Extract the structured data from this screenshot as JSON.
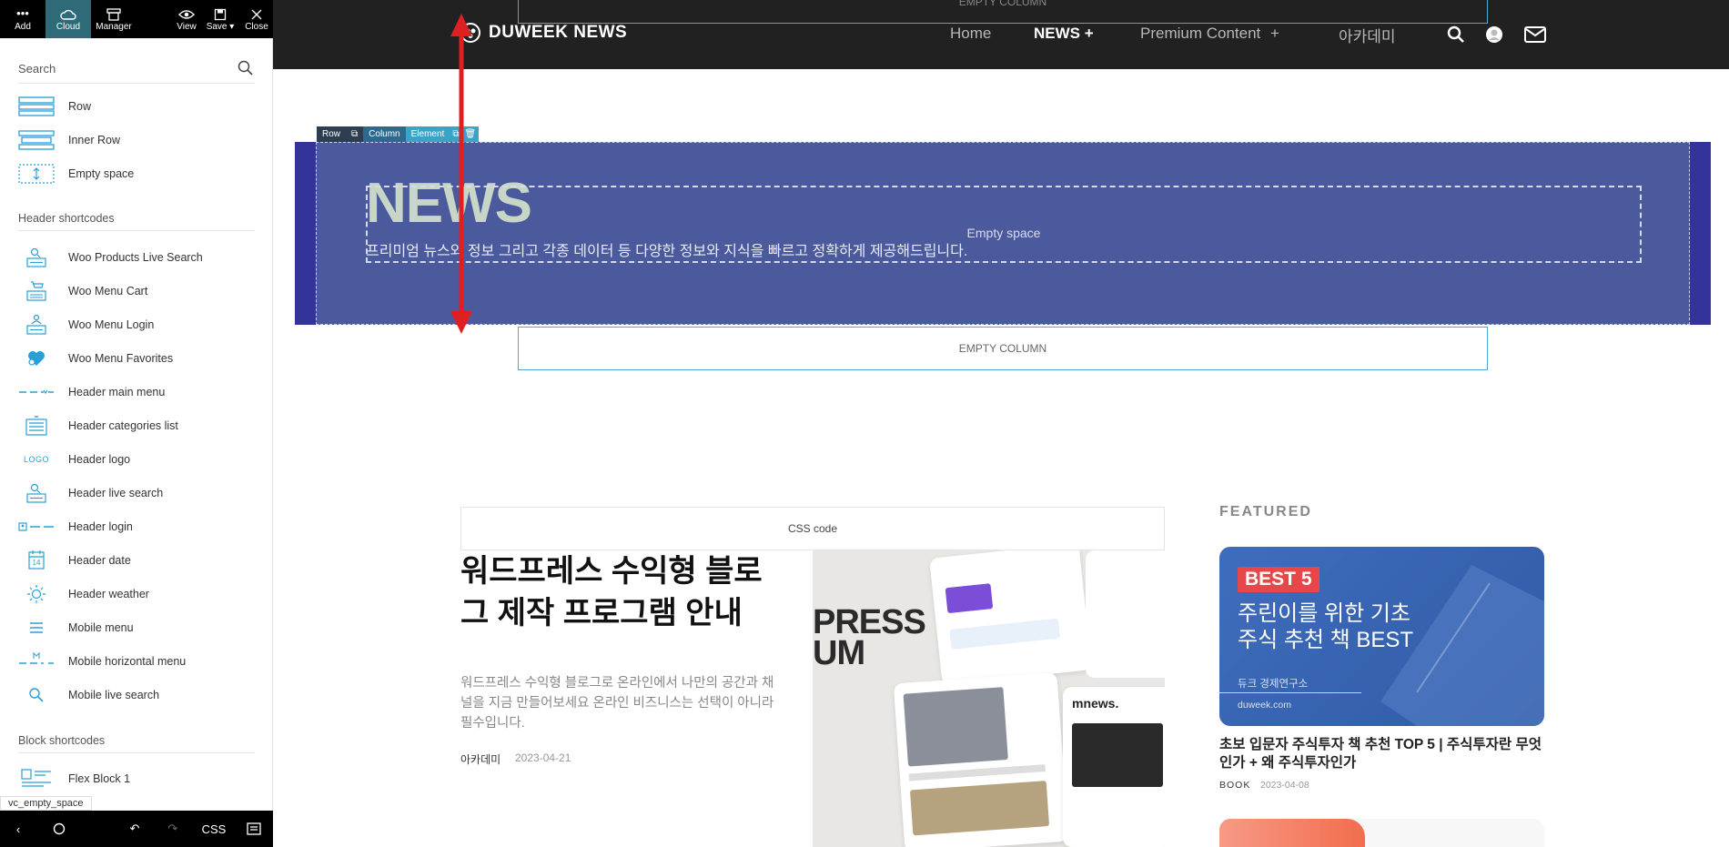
{
  "toolbar": {
    "add_label": "Add",
    "cloud_label": "Cloud",
    "manager_label": "Manager",
    "view_label": "View",
    "save_label": "Save",
    "close_label": "Close"
  },
  "panel": {
    "search_placeholder": "Search",
    "basic_items": [
      {
        "label": "Row",
        "icon": "row-icon"
      },
      {
        "label": "Inner Row",
        "icon": "inner-row-icon"
      },
      {
        "label": "Empty space",
        "icon": "empty-space-icon"
      }
    ],
    "header_section_title": "Header shortcodes",
    "header_items": [
      {
        "label": "Woo Products Live Search",
        "icon": "live-search-icon"
      },
      {
        "label": "Woo Menu Cart",
        "icon": "cart-icon"
      },
      {
        "label": "Woo Menu Login",
        "icon": "login-icon"
      },
      {
        "label": "Woo Menu Favorites",
        "icon": "heart-icon"
      },
      {
        "label": "Header main menu",
        "icon": "main-menu-icon"
      },
      {
        "label": "Header categories list",
        "icon": "categories-icon"
      },
      {
        "label": "Header logo",
        "icon": "logo-icon"
      },
      {
        "label": "Header live search",
        "icon": "live-search-icon"
      },
      {
        "label": "Header login",
        "icon": "login-icon"
      },
      {
        "label": "Header date",
        "icon": "calendar-icon"
      },
      {
        "label": "Header weather",
        "icon": "sun-icon"
      },
      {
        "label": "Mobile menu",
        "icon": "hamburger-icon"
      },
      {
        "label": "Mobile horizontal menu",
        "icon": "horizontal-menu-icon"
      },
      {
        "label": "Mobile live search",
        "icon": "search-icon"
      }
    ],
    "block_section_title": "Block shortcodes",
    "block_items": [
      {
        "label": "Flex Block 1",
        "icon": "flex-block-icon"
      }
    ],
    "logo_icon_text": "LOGO",
    "date_icon_text": "14",
    "tooltip": "vc_empty_space"
  },
  "bottom_bar": {
    "css_label": "CSS"
  },
  "site": {
    "logo_text": "DUWEEK NEWS",
    "nav": {
      "home": "Home",
      "news": "NEWS",
      "news_plus": "+",
      "premium": "Premium Content",
      "premium_plus": "+",
      "academy": "아카데미"
    }
  },
  "builder": {
    "empty_column_label": "EMPTY COLUMN",
    "row_label": "Row",
    "column_label": "Column",
    "element_label": "Element",
    "empty_space_label": "Empty space",
    "css_code_label": "CSS code"
  },
  "hero": {
    "title": "NEWS",
    "subtitle": "프리미엄 뉴스와 정보 그리고 각종 데이터 등 다양한 정보와 지식을 빠르고 정확하게 제공해드립니다."
  },
  "post": {
    "title": "워드프레스 수익형 블로그 제작 프로그램 안내",
    "excerpt": "워드프레스 수익형 블로그로 온라인에서 나만의 공간과 채널을 지금 만들어보세요 온라인 비즈니스는 선택이 아니라 필수입니다.",
    "author": "아카데미",
    "date": "2023-04-21",
    "thumb_text_1": "PRESS",
    "thumb_text_2": "UM",
    "thumb_brand": "mnews."
  },
  "featured": {
    "section_title": "FEATURED",
    "badge": "BEST 5",
    "line1": "주린이를 위한 기초",
    "line2": "주식 추천 책 BEST",
    "org": "듀크 경제연구소",
    "url": "duweek.com",
    "post_title": "초보 입문자 주식투자 책 추천 TOP 5 | 주식투자란 무엇인가 + 왜 주식투자인가",
    "category": "BOOK",
    "date": "2023-04-08"
  },
  "colors": {
    "toolbar_bg": "#000000",
    "cloud_active": "#2e6a78",
    "header_bg": "#212121",
    "hero_row_bg": "#34339c",
    "hero_inner_bg": "#4b5a9c",
    "hero_title": "#c7d6c7",
    "arrow": "#e02020",
    "featured_card": "#3f6dbd",
    "badge": "#e8474a"
  }
}
